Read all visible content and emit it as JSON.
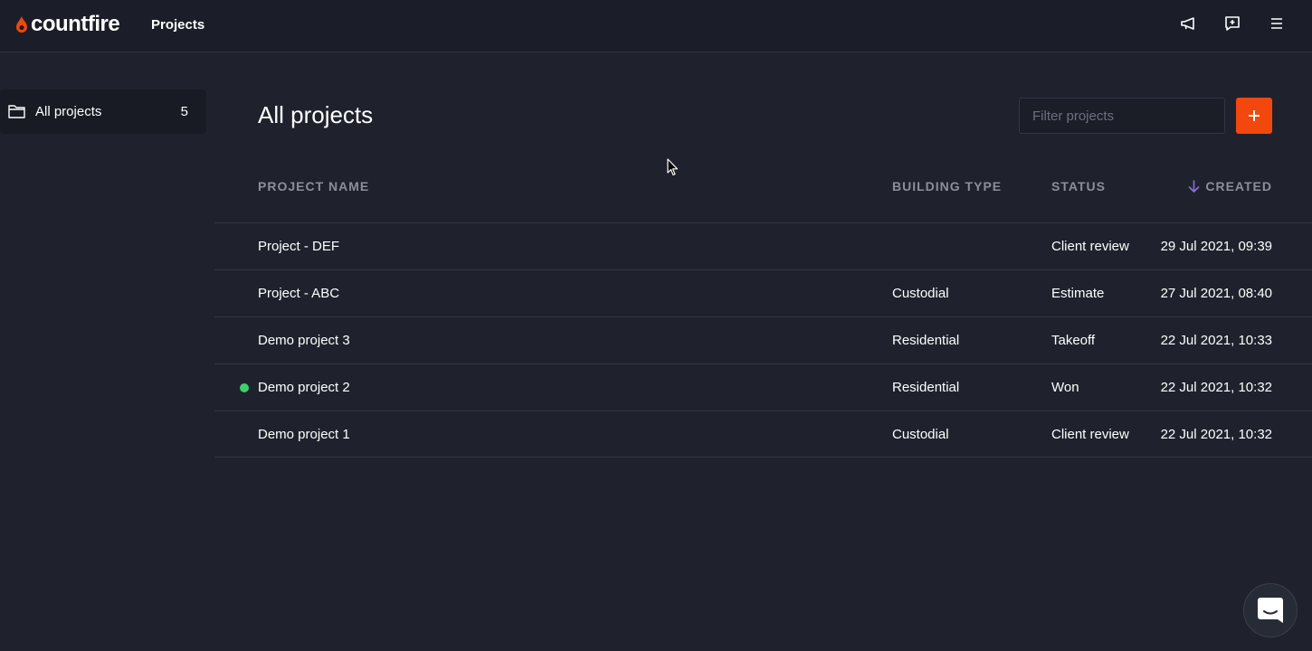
{
  "header": {
    "logo_text": "countfire",
    "nav_title": "Projects",
    "icons": [
      "megaphone-icon",
      "feedback-icon",
      "menu-icon"
    ]
  },
  "sidebar": {
    "items": [
      {
        "label": "All projects",
        "count": "5",
        "icon": "folder-icon"
      }
    ]
  },
  "main": {
    "title": "All projects",
    "filter_placeholder": "Filter projects",
    "add_label": "+",
    "table": {
      "columns": [
        "PROJECT NAME",
        "BUILDING TYPE",
        "STATUS",
        "CREATED"
      ],
      "sort_column": "CREATED",
      "rows": [
        {
          "name": "Project - DEF",
          "building_type": "",
          "status": "Client review",
          "created": "29 Jul 2021, 09:39",
          "indicator": false
        },
        {
          "name": "Project - ABC",
          "building_type": "Custodial",
          "status": "Estimate",
          "created": "27 Jul 2021, 08:40",
          "indicator": false
        },
        {
          "name": "Demo project 3",
          "building_type": "Residential",
          "status": "Takeoff",
          "created": "22 Jul 2021, 10:33",
          "indicator": false
        },
        {
          "name": "Demo project 2",
          "building_type": "Residential",
          "status": "Won",
          "created": "22 Jul 2021, 10:32",
          "indicator": true
        },
        {
          "name": "Demo project 1",
          "building_type": "Custodial",
          "status": "Client review",
          "created": "22 Jul 2021, 10:32",
          "indicator": false
        }
      ]
    }
  },
  "colors": {
    "accent": "#f2480d",
    "indicator_green": "#3fce6d",
    "background": "#1f222d"
  }
}
